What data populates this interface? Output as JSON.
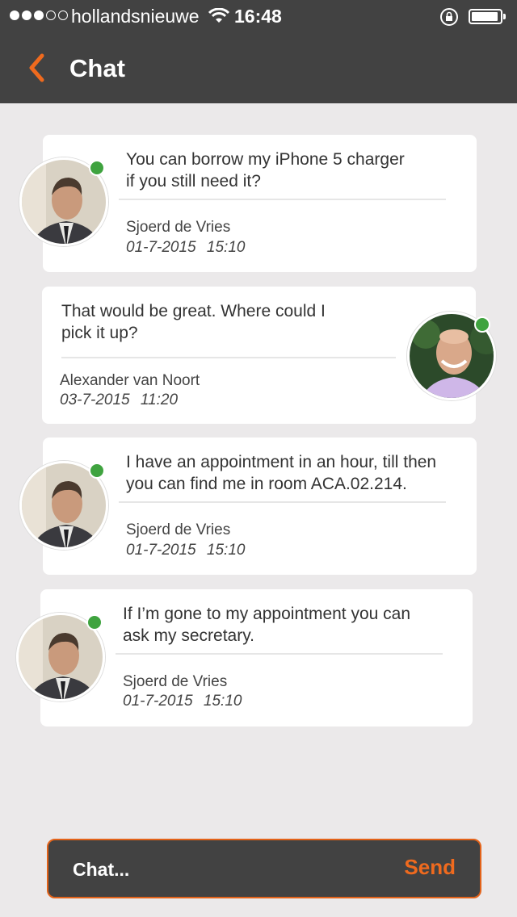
{
  "status_bar": {
    "carrier": "hollandsnieuwe",
    "time": "16:48",
    "signal_bars_filled": 3,
    "signal_bars_total": 5
  },
  "nav": {
    "title": "Chat",
    "back_icon": "chevron-left-icon",
    "accent_color": "#ef6a1e"
  },
  "messages": [
    {
      "text_line1": "You can borrow my iPhone 5 charger",
      "text_line2": "if you still need it?",
      "author": "Sjoerd de Vries",
      "stamp": "01-7-2015 15:10",
      "online": true
    },
    {
      "text_line1": "That would be great. Where could I",
      "text_line2": "pick it up?",
      "author": "Alexander van Noort",
      "stamp": "03-7-2015 11:20",
      "online": true
    },
    {
      "text_line1": "I have an appointment in an hour, till then",
      "text_line2": "you can find me in room ACA.02.214.",
      "author": "Sjoerd de Vries",
      "stamp": "01-7-2015 15:10",
      "online": true
    },
    {
      "text_line1": "If I’m gone to my appointment you can",
      "text_line2": "ask my secretary.",
      "author": "Sjoerd de Vries",
      "stamp": "01-7-2015 15:10",
      "online": true
    }
  ],
  "composer": {
    "placeholder": "Chat...",
    "send_label": "Send"
  }
}
